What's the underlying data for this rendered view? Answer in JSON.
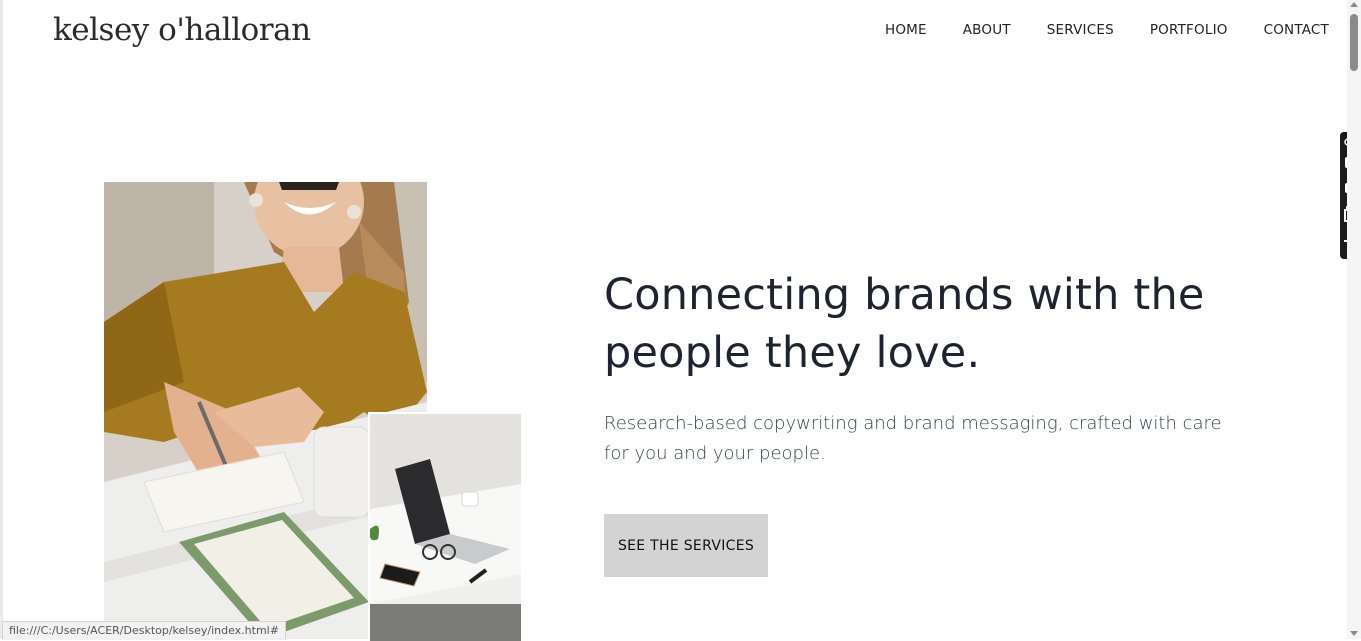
{
  "header": {
    "logo": "kelsey o'halloran",
    "nav": [
      "HOME",
      "ABOUT",
      "SERVICES",
      "PORTFOLIO",
      "CONTACT"
    ]
  },
  "hero": {
    "title": "Connecting brands with the people they love.",
    "subtitle": "Research-based copywriting and brand messaging, crafted with care for you and your people.",
    "cta_label": "SEE THE SERVICES",
    "main_image": "woman-writing-photo",
    "inset_image": "laptop-desk-photo"
  },
  "side_toolbar": {
    "icons": [
      "link-icon",
      "camera-icon",
      "video-icon",
      "window-icon",
      "gear-icon"
    ]
  },
  "status_bar": {
    "url": "file:///C:/Users/ACER/Desktop/kelsey/index.html#"
  },
  "colors": {
    "text": "#1e2330",
    "cta_bg": "#d4d3d3",
    "toolbar_bg": "#1a1a1a"
  }
}
